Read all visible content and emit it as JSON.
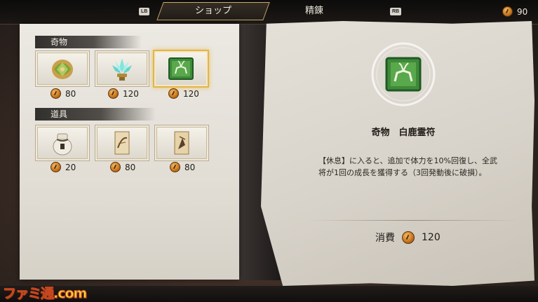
{
  "tabs": {
    "left_button": "LB",
    "active": "ショップ",
    "inactive": "精錬",
    "right_button": "RB"
  },
  "currency": {
    "amount": "90",
    "icon": "coin-icon"
  },
  "sections": [
    {
      "title": "奇物",
      "items": [
        {
          "name": "green-jade-relic",
          "price": "80",
          "icon": "jade-charm-icon"
        },
        {
          "name": "crystal-lotus",
          "price": "120",
          "icon": "crystal-lotus-icon"
        },
        {
          "name": "white-deer-talisman",
          "price": "120",
          "icon": "deer-talisman-icon",
          "selected": true
        }
      ]
    },
    {
      "title": "道具",
      "items": [
        {
          "name": "sealed-jar",
          "price": "20",
          "icon": "jar-icon"
        },
        {
          "name": "scroll-painting-1",
          "price": "80",
          "icon": "scroll-icon"
        },
        {
          "name": "scroll-painting-2",
          "price": "80",
          "icon": "scroll-icon"
        }
      ]
    }
  ],
  "detail": {
    "title": "奇物　白鹿霊符",
    "description": "【休息】に入ると、追加で体力を10%回復し、全武将が1回の成長を獲得する（3回発動後に破損）。",
    "cost_label": "消費",
    "cost_value": "120"
  },
  "watermark": "ファミ通.com",
  "colors": {
    "accent_gold": "#e1b54a",
    "parchment": "#e4e0d8",
    "coin": "#c9781f"
  }
}
